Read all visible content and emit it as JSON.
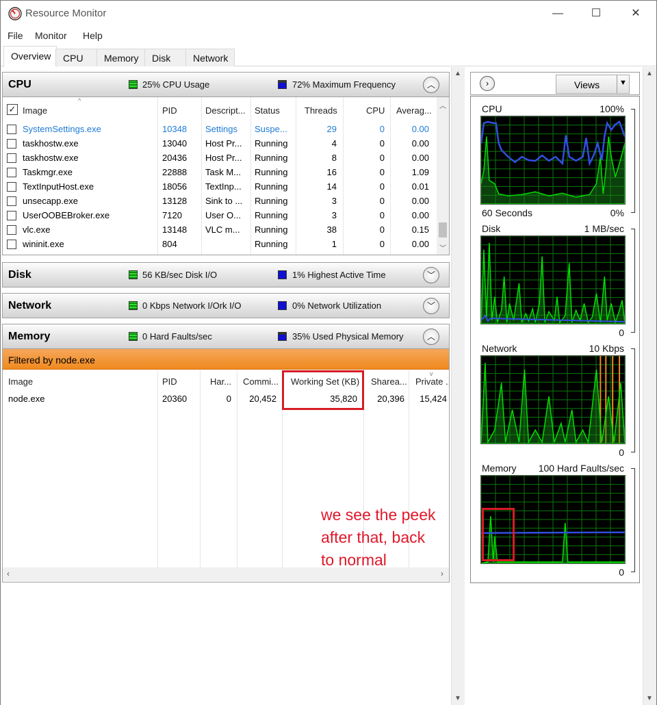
{
  "window": {
    "title": "Resource Monitor",
    "minimize": "—",
    "maximize": "☐",
    "close": "✕"
  },
  "menu": [
    "File",
    "Monitor",
    "Help"
  ],
  "tabs": [
    "Overview",
    "CPU",
    "Memory",
    "Disk",
    "Network"
  ],
  "cpu": {
    "title": "CPU",
    "usage": "25% CPU Usage",
    "frequency": "72% Maximum Frequency",
    "columns": [
      "Image",
      "PID",
      "Descript...",
      "Status",
      "Threads",
      "CPU",
      "Averag..."
    ],
    "rows": [
      [
        "SystemSettings.exe",
        "10348",
        "Settings",
        "Suspe...",
        "29",
        "0",
        "0.00"
      ],
      [
        "taskhostw.exe",
        "13040",
        "Host Pr...",
        "Running",
        "4",
        "0",
        "0.00"
      ],
      [
        "taskhostw.exe",
        "20436",
        "Host Pr...",
        "Running",
        "8",
        "0",
        "0.00"
      ],
      [
        "Taskmgr.exe",
        "22888",
        "Task M...",
        "Running",
        "16",
        "0",
        "1.09"
      ],
      [
        "TextInputHost.exe",
        "18056",
        "TextInp...",
        "Running",
        "14",
        "0",
        "0.01"
      ],
      [
        "unsecapp.exe",
        "13128",
        "Sink to ...",
        "Running",
        "3",
        "0",
        "0.00"
      ],
      [
        "UserOOBEBroker.exe",
        "7120",
        "User O...",
        "Running",
        "3",
        "0",
        "0.00"
      ],
      [
        "vlc.exe",
        "13148",
        "VLC m...",
        "Running",
        "38",
        "0",
        "0.15"
      ],
      [
        "wininit.exe",
        "804",
        "",
        "Running",
        "1",
        "0",
        "0.00"
      ]
    ]
  },
  "disk": {
    "title": "Disk",
    "io": "56 KB/sec Disk I/O",
    "active": "1% Highest Active Time"
  },
  "network": {
    "title": "Network",
    "io": "0 Kbps Network I/Ork I/O",
    "util": "0% Network Utilization"
  },
  "memory": {
    "title": "Memory",
    "faults": "0 Hard Faults/sec",
    "used": "35% Used Physical Memory",
    "filter": "Filtered by node.exe",
    "columns": [
      "Image",
      "PID",
      "Har...",
      "Commi...",
      "Working Set (KB)",
      "Sharea...",
      "Private ..."
    ],
    "rows": [
      [
        "node.exe",
        "20360",
        "0",
        "20,452",
        "35,820",
        "20,396",
        "15,424"
      ]
    ]
  },
  "right": {
    "views": "Views",
    "graphs": [
      {
        "title": "CPU",
        "max": "100%",
        "foot_left": "60 Seconds",
        "foot_right": "0%"
      },
      {
        "title": "Disk",
        "max": "1 MB/sec",
        "foot_left": "",
        "foot_right": "0"
      },
      {
        "title": "Network",
        "max": "10 Kbps",
        "foot_left": "",
        "foot_right": "0"
      },
      {
        "title": "Memory",
        "max": "100 Hard Faults/sec",
        "foot_left": "",
        "foot_right": "0"
      }
    ]
  },
  "annotation": "we see the peek\nafter that, back\nto normal",
  "colors": {
    "green": "#00e000",
    "blue": "#2f4de0",
    "orange": "#f08a1e",
    "annotation": "#e0182a"
  }
}
